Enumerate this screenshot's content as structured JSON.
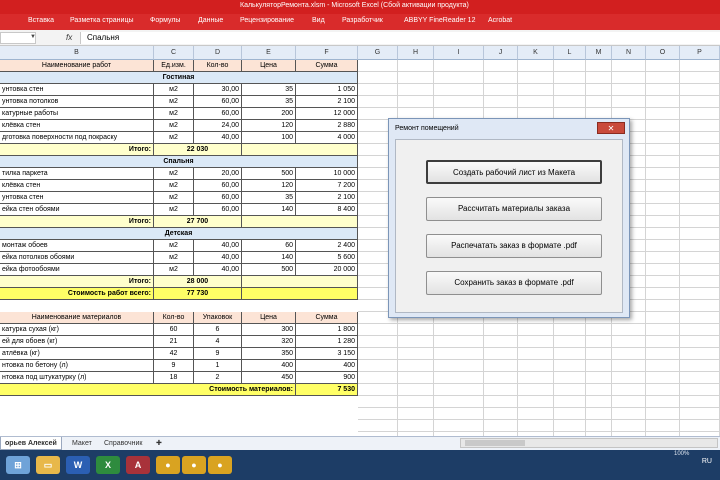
{
  "window": {
    "title": "КалькуляторРемонта.xlsm - Microsoft Excel (Сбой активации продукта)"
  },
  "ribbon": {
    "tabs": [
      "Вставка",
      "Разметка страницы",
      "Формулы",
      "Данные",
      "Рецензирование",
      "Вид",
      "Разработчик",
      "ABBYY FineReader 12",
      "Acrobat"
    ]
  },
  "formula_bar": {
    "name_box": "",
    "fx": "fx",
    "value": "Спальня"
  },
  "columns": [
    "B",
    "C",
    "D",
    "E",
    "F",
    "G",
    "H",
    "I",
    "J",
    "K",
    "L",
    "M",
    "N",
    "O",
    "P"
  ],
  "table1": {
    "header": [
      "Наименование работ",
      "Ед.изм.",
      "Кол-во",
      "Цена",
      "Сумма"
    ],
    "sections": [
      {
        "name": "Гостиная",
        "rows": [
          [
            "унтовка стен",
            "м2",
            "30,00",
            "35",
            "1 050"
          ],
          [
            "унтовка потолков",
            "м2",
            "60,00",
            "35",
            "2 100"
          ],
          [
            "катурные работы",
            "м2",
            "60,00",
            "200",
            "12 000"
          ],
          [
            "клёвка стен",
            "м2",
            "24,00",
            "120",
            "2 880"
          ],
          [
            "дготовка поверхности под покраску",
            "м2",
            "40,00",
            "100",
            "4 000"
          ]
        ],
        "total_label": "Итого:",
        "total": "22 030"
      },
      {
        "name": "Спальня",
        "rows": [
          [
            "тилка паркета",
            "м2",
            "20,00",
            "500",
            "10 000"
          ],
          [
            "клёвка стен",
            "м2",
            "60,00",
            "120",
            "7 200"
          ],
          [
            "унтовка стен",
            "м2",
            "60,00",
            "35",
            "2 100"
          ],
          [
            "ейка стен обоями",
            "м2",
            "60,00",
            "140",
            "8 400"
          ]
        ],
        "total_label": "Итого:",
        "total": "27 700"
      },
      {
        "name": "Детская",
        "rows": [
          [
            "монтаж обоев",
            "м2",
            "40,00",
            "60",
            "2 400"
          ],
          [
            "ейка потолков обоями",
            "м2",
            "40,00",
            "140",
            "5 600"
          ],
          [
            "ейка фотообоями",
            "м2",
            "40,00",
            "500",
            "20 000"
          ]
        ],
        "total_label": "Итого:",
        "total": "28 000"
      }
    ],
    "grand_label": "Стоимость работ всего:",
    "grand_total": "77 730"
  },
  "table2": {
    "header": [
      "Наименование материалов",
      "Кол-во",
      "Упаковок",
      "Цена",
      "Сумма"
    ],
    "rows": [
      [
        "катурка сухая (кг)",
        "60",
        "6",
        "300",
        "1 800"
      ],
      [
        "ей для обоев (кг)",
        "21",
        "4",
        "320",
        "1 280"
      ],
      [
        "атлёвка (кг)",
        "42",
        "9",
        "350",
        "3 150"
      ],
      [
        "нтовка по бетону (л)",
        "9",
        "1",
        "400",
        "400"
      ],
      [
        "нтовка под штукатурку (л)",
        "18",
        "2",
        "450",
        "900"
      ]
    ],
    "total_label": "Стоимость материалов:",
    "total": "7 530"
  },
  "dialog": {
    "title": "Ремонт помещений",
    "close_label": "✕",
    "buttons": [
      "Создать рабочий лист из Макета",
      "Рассчитать материалы заказа",
      "Распечатать заказ в формате .pdf",
      "Сохранить заказ в формате .pdf"
    ]
  },
  "sheet_tabs": [
    "орьев Алексей",
    "Макет",
    "Справочник"
  ],
  "status": {
    "zoom": "100%"
  },
  "taskbar": {
    "lang": "RU"
  },
  "icons": [
    "folder-icon",
    "word-icon",
    "excel-icon",
    "access-icon",
    "chrome-icon",
    "chrome-icon",
    "chrome-icon"
  ]
}
